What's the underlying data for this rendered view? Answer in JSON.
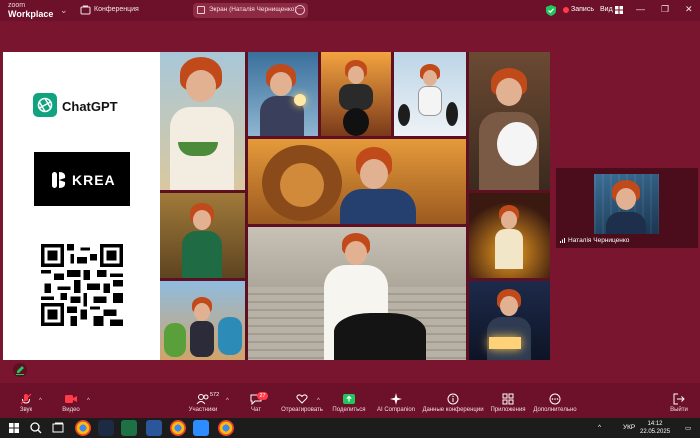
{
  "app": {
    "logo_line1": "zoom",
    "logo_line2": "Workplace"
  },
  "topbar": {
    "conference_label": "Конференция",
    "screen_chip": "Экран (Наталія Чернищенко)",
    "recording_label": "Запись",
    "view_label": "Вид"
  },
  "shared_screen": {
    "chatgpt_label": "ChatGPT",
    "krea_label": "KREA"
  },
  "self_view": {
    "name": "Наталія Черниценко"
  },
  "toolbar": {
    "audio": "Звук",
    "video": "Видео",
    "participants": "Участники",
    "participants_count": "572",
    "chat": "Чат",
    "chat_badge": "27",
    "react": "Отреагировать",
    "share": "Поделиться",
    "ai_companion": "AI Companion",
    "meeting_info": "Данные конференции",
    "apps": "Приложения",
    "more": "Дополнительно",
    "leave": "Выйти"
  },
  "taskbar": {
    "language": "УКР",
    "time": "14:12",
    "date": "22.05.2025"
  },
  "colors": {
    "background": "#7a1530",
    "bar": "#6d1029",
    "recording": "#ff3b4a",
    "share_green": "#22c55e",
    "chatgpt": "#10a37f"
  },
  "icons": [
    "chevron-down-icon",
    "conference-icon",
    "screen-icon",
    "more-icon",
    "shield-icon",
    "record-icon",
    "grid-icon",
    "minimize-icon",
    "maximize-icon",
    "close-icon",
    "mic-icon",
    "video-icon",
    "participants-icon",
    "chat-icon",
    "heart-icon",
    "share-icon",
    "sparkle-icon",
    "info-icon",
    "apps-icon",
    "more-dots-icon",
    "leave-icon",
    "windows-icon",
    "search-icon",
    "taskview-icon",
    "chrome-icon",
    "excel-icon",
    "word-icon",
    "zoom-icon"
  ]
}
